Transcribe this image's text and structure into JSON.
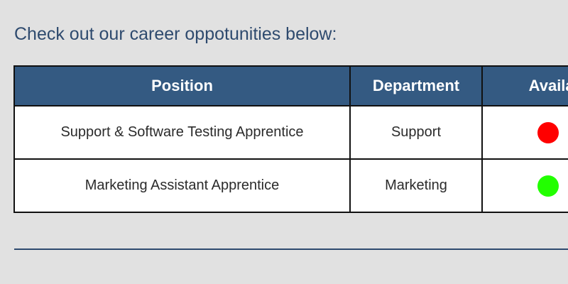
{
  "intro_text": "Check out our career oppotunities below:",
  "table": {
    "headers": {
      "position": "Position",
      "department": "Department",
      "availability": "Availabil"
    },
    "rows": [
      {
        "position": "Support & Software Testing Apprentice",
        "department": "Support",
        "availability_status": "unavailable",
        "availability_color": "#ff0000"
      },
      {
        "position": "Marketing Assistant Apprentice",
        "department": "Marketing",
        "availability_status": "available",
        "availability_color": "#22ff00"
      }
    ]
  },
  "colors": {
    "page_background": "#e1e1e1",
    "header_background": "#345a82",
    "heading_text": "#2e4a6e"
  }
}
